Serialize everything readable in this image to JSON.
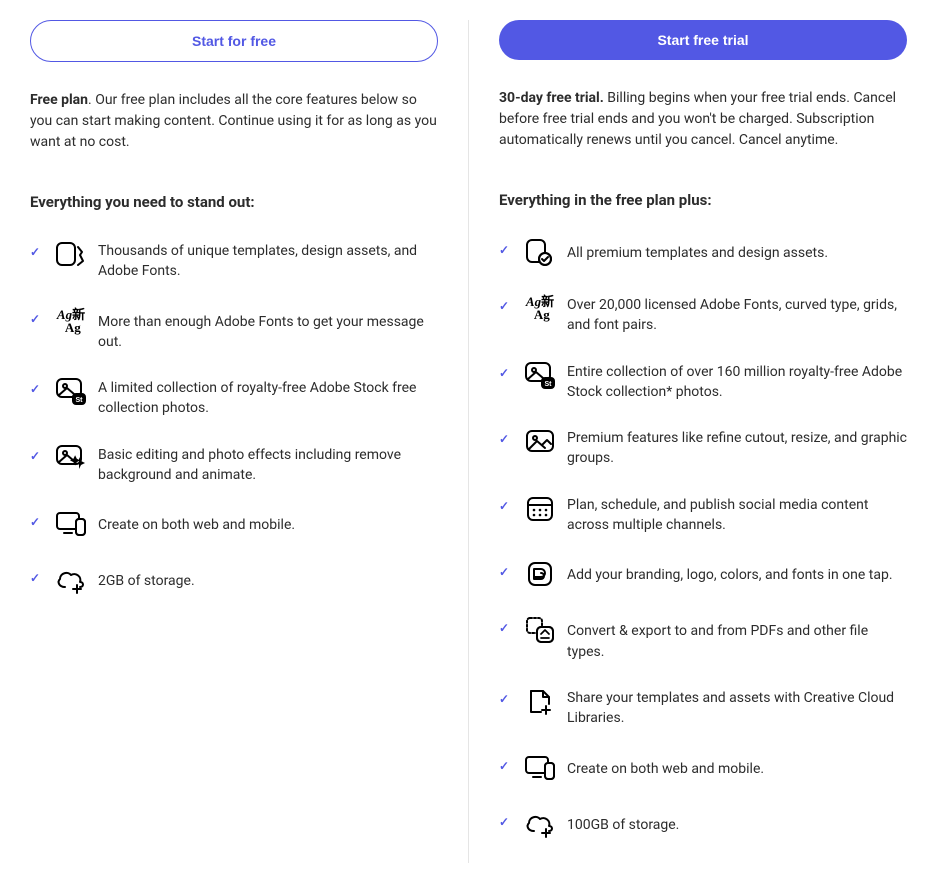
{
  "free": {
    "cta": "Start for free",
    "lead": "Free plan",
    "desc": ". Our free plan includes all the core features below so you can start making content. Continue using it for as long as you want at no cost.",
    "section_title": "Everything you need to stand out:",
    "features": [
      "Thousands of unique templates, design assets, and Adobe Fonts.",
      "More than enough Adobe Fonts to get your message out.",
      "A limited collection of royalty-free Adobe Stock free collection photos.",
      "Basic editing and photo effects including remove background and animate.",
      "Create on both web and mobile.",
      "2GB of storage."
    ]
  },
  "premium": {
    "cta": "Start free trial",
    "lead": "30-day free trial.",
    "desc": " Billing begins when your free trial ends. Cancel before free trial ends and you won't be charged. Subscription automatically renews until you cancel. Cancel anytime.",
    "section_title": "Everything in the free plan plus:",
    "features": [
      "All premium templates and design assets.",
      "Over 20,000 licensed Adobe Fonts, curved type, grids, and font pairs.",
      "Entire collection of over 160 million royalty-free Adobe Stock collection* photos.",
      "Premium features like refine cutout, resize, and graphic groups.",
      "Plan, schedule, and publish social media content across multiple channels.",
      "Add your branding, logo, colors, and fonts in one tap.",
      "Convert & export to and from PDFs and other file types.",
      "Share your templates and assets with Creative Cloud Libraries.",
      "Create on both web and mobile.",
      "100GB of storage."
    ]
  }
}
